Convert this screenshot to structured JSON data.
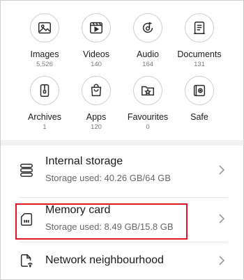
{
  "categories": [
    {
      "label": "Images",
      "count": "5,526",
      "icon": "images-icon"
    },
    {
      "label": "Videos",
      "count": "140",
      "icon": "videos-icon"
    },
    {
      "label": "Audio",
      "count": "164",
      "icon": "audio-icon"
    },
    {
      "label": "Documents",
      "count": "131",
      "icon": "documents-icon"
    },
    {
      "label": "Archives",
      "count": "1",
      "icon": "archives-icon"
    },
    {
      "label": "Apps",
      "count": "120",
      "icon": "apps-icon"
    },
    {
      "label": "Favourites",
      "count": "0",
      "icon": "favourites-icon"
    },
    {
      "label": "Safe",
      "count": "",
      "icon": "safe-icon"
    }
  ],
  "storage": [
    {
      "title": "Internal storage",
      "subtitle": "Storage used: 40.26 GB/64 GB",
      "icon": "internal-storage-icon"
    },
    {
      "title": "Memory card",
      "subtitle": "Storage used: 8.49 GB/15.8 GB",
      "icon": "memory-card-icon",
      "highlighted": true
    },
    {
      "title": "Network neighbourhood",
      "subtitle": "",
      "icon": "network-icon"
    }
  ],
  "colors": {
    "highlight": "#e0141e",
    "icon_stroke": "#2a2a2a",
    "secondary_text": "#666666"
  }
}
